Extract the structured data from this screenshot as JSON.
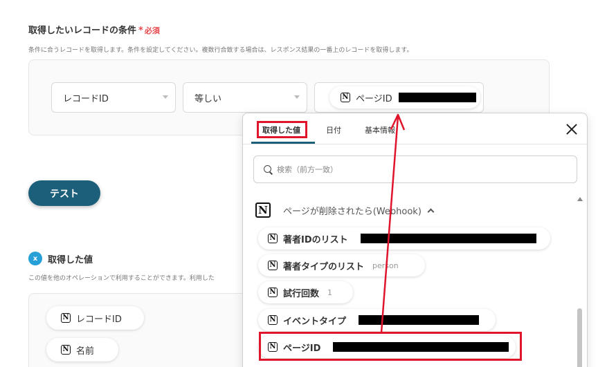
{
  "condition_section": {
    "title": "取得したいレコードの条件",
    "required_star": "*",
    "required_label": "必須",
    "description": "条件に合うレコードを取得します。条件を設定してください。複数行合致する場合は、レスポンス結果の一番上のレコードを取得します。",
    "field_select": "レコードID",
    "operator_select": "等しい",
    "value_chip_label": "ページID"
  },
  "test_button": {
    "label": "テスト"
  },
  "retrieved_section": {
    "badge": "x",
    "title": "取得した値",
    "description": "この値を他のオペレーションで利用することができます。利用した",
    "chips": [
      "レコードID",
      "名前"
    ]
  },
  "popup": {
    "tabs": [
      {
        "label": "取得した値",
        "active": true
      },
      {
        "label": "日付",
        "active": false
      },
      {
        "label": "基本情報",
        "active": false
      }
    ],
    "search_placeholder": "検索（前方一致）",
    "group_title": "ページが削除されたら(Webhook)",
    "items": [
      {
        "label": "著者IDのリスト",
        "value": ""
      },
      {
        "label": "著者タイプのリスト",
        "value": "person"
      },
      {
        "label": "試行回数",
        "value": "1"
      },
      {
        "label": "イベントタイプ",
        "value": ""
      },
      {
        "label": "ページID",
        "value": ""
      }
    ]
  },
  "icons": {
    "notion": "N",
    "close": "close-icon",
    "search": "search-icon",
    "chevron_down": "chevron-down-icon",
    "chevron_up": "chevron-up-icon"
  },
  "colors": {
    "primary": "#1c5f7a",
    "required": "#e5484d",
    "highlight": "#e0142b",
    "badge": "#27a0d8"
  }
}
